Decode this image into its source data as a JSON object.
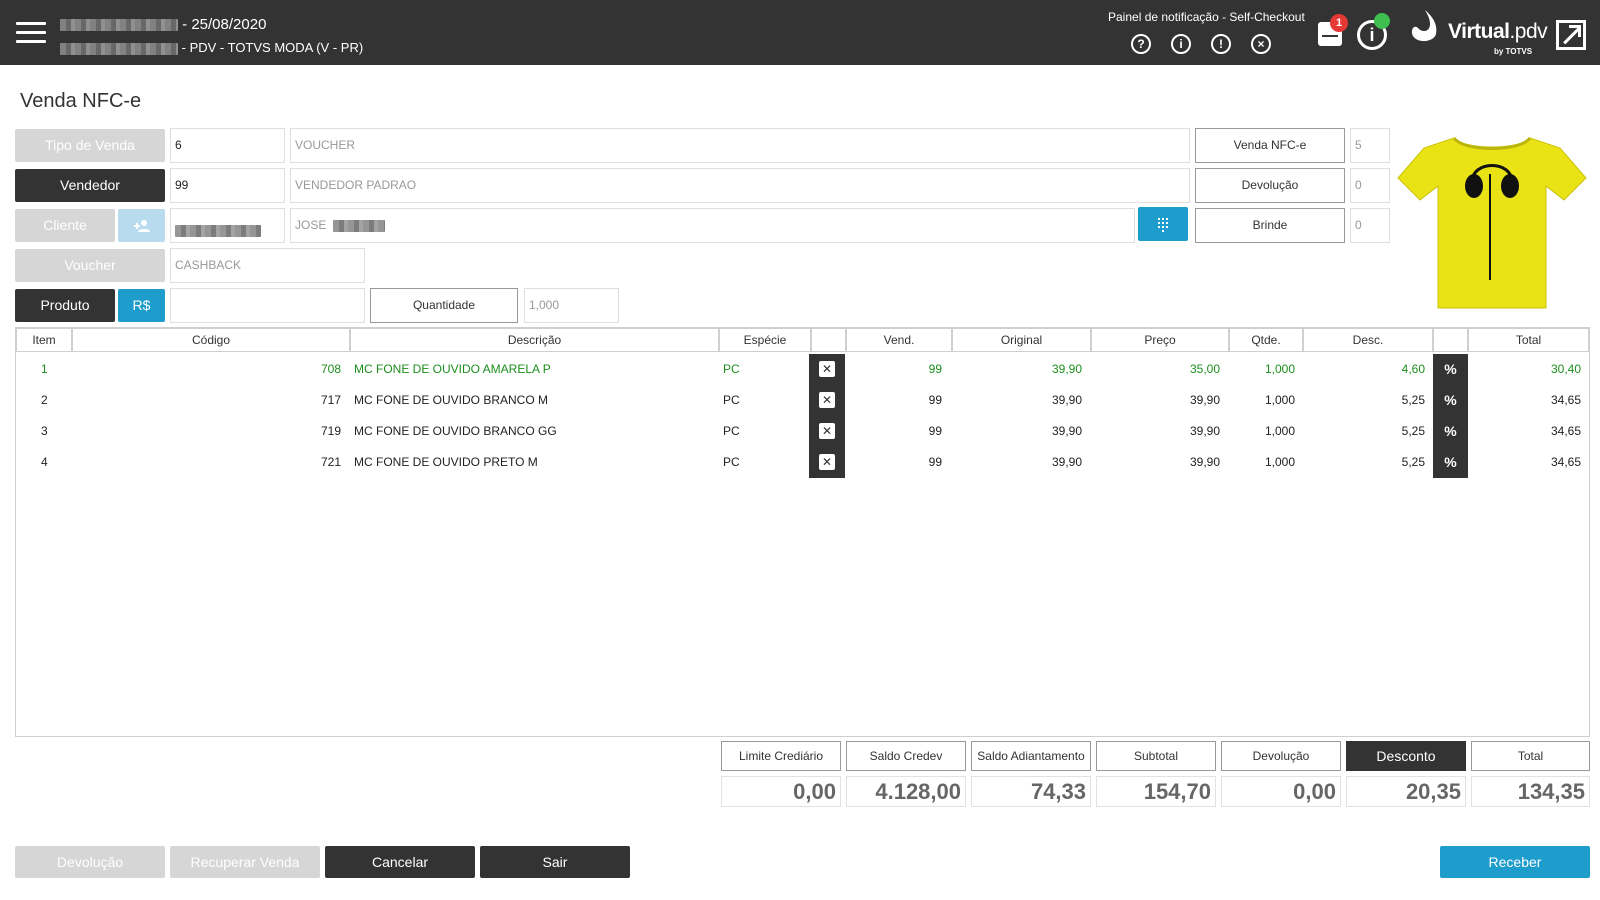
{
  "header": {
    "store_name_redacted": true,
    "date_suffix": "- 25/08/2020",
    "pdv_line": "- PDV - TOTVS MODA (V - PR)",
    "notification_panel": "Painel de notificação - Self-Checkout",
    "device_badge": "1",
    "brand": {
      "name": "Virtual",
      "suffix": ".pdv",
      "sub": "by TOTVS"
    }
  },
  "page": {
    "title": "Venda NFC-e"
  },
  "form": {
    "tipo_venda": {
      "label": "Tipo de Venda",
      "code": "6",
      "description": "VOUCHER"
    },
    "vendedor": {
      "label": "Vendedor",
      "code": "99",
      "description": "VENDEDOR PADRAO"
    },
    "cliente": {
      "label": "Cliente",
      "name": "JOSE"
    },
    "voucher": {
      "label": "Voucher",
      "value": "CASHBACK"
    },
    "produto": {
      "label": "Produto",
      "currency_button": "R$",
      "value": ""
    },
    "quantidade": {
      "label": "Quantidade",
      "value": "1,000"
    },
    "counters": [
      {
        "label": "Venda NFC-e",
        "value": "5"
      },
      {
        "label": "Devolução",
        "value": "0"
      },
      {
        "label": "Brinde",
        "value": "0"
      }
    ]
  },
  "table": {
    "headers": [
      "Item",
      "Código",
      "Descrição",
      "Espécie",
      "",
      "Vend.",
      "Original",
      "Preço",
      "Qtde.",
      "Desc.",
      "",
      "Total"
    ],
    "rows": [
      {
        "item": "1",
        "codigo": "708",
        "descricao": "MC FONE DE OUVIDO AMARELA P",
        "especie": "PC",
        "vend": "99",
        "original": "39,90",
        "preco": "35,00",
        "qtde": "1,000",
        "desc": "4,60",
        "total": "30,40",
        "highlight": true
      },
      {
        "item": "2",
        "codigo": "717",
        "descricao": "MC FONE DE OUVIDO BRANCO M",
        "especie": "PC",
        "vend": "99",
        "original": "39,90",
        "preco": "39,90",
        "qtde": "1,000",
        "desc": "5,25",
        "total": "34,65",
        "highlight": false
      },
      {
        "item": "3",
        "codigo": "719",
        "descricao": "MC FONE DE OUVIDO BRANCO GG",
        "especie": "PC",
        "vend": "99",
        "original": "39,90",
        "preco": "39,90",
        "qtde": "1,000",
        "desc": "5,25",
        "total": "34,65",
        "highlight": false
      },
      {
        "item": "4",
        "codigo": "721",
        "descricao": "MC FONE DE OUVIDO PRETO M",
        "especie": "PC",
        "vend": "99",
        "original": "39,90",
        "preco": "39,90",
        "qtde": "1,000",
        "desc": "5,25",
        "total": "34,65",
        "highlight": false
      }
    ]
  },
  "totals": [
    {
      "label": "Limite Crediário",
      "value": "0,00"
    },
    {
      "label": "Saldo Credev",
      "value": "4.128,00"
    },
    {
      "label": "Saldo Adiantamento",
      "value": "74,33"
    },
    {
      "label": "Subtotal",
      "value": "154,70"
    },
    {
      "label": "Devolução",
      "value": "0,00"
    },
    {
      "label": "Desconto",
      "value": "20,35"
    },
    {
      "label": "Total",
      "value": "134,35"
    }
  ],
  "actions": {
    "devolucao": "Devolução",
    "recuperar": "Recuperar Venda",
    "cancelar": "Cancelar",
    "sair": "Sair",
    "receber": "Receber"
  },
  "colors": {
    "topbar": "#333333",
    "accent_blue": "#1e9ccc",
    "highlight_green": "#1d8f1d",
    "disabled": "#d6d6d6"
  }
}
